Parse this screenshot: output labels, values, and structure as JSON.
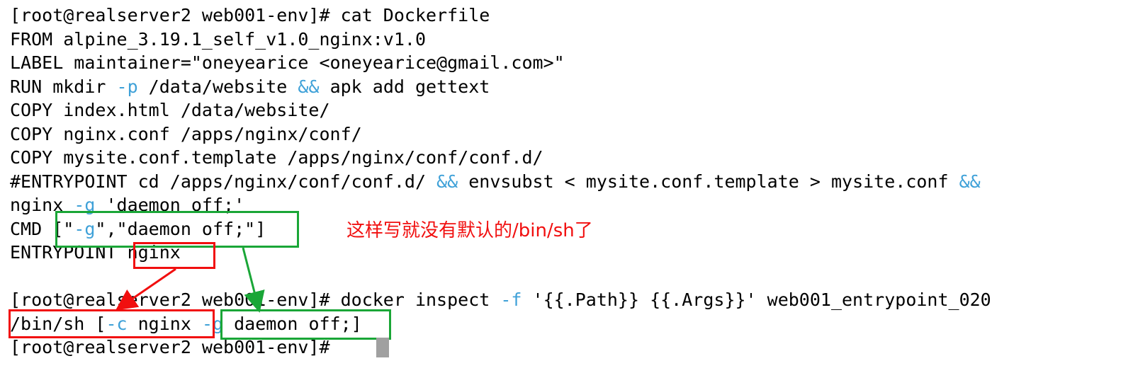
{
  "colors": {
    "background": "#ffffff",
    "text": "#000000",
    "flag_highlight": "#3fa1d8",
    "green_box": "#1aa637",
    "red_box": "#f10f0f",
    "annotation_text": "#f10f0f",
    "cursor": "#a0a0a0"
  },
  "terminal": {
    "lines": [
      [
        {
          "t": "[root@realserver2 web001-env]# cat Dockerfile"
        }
      ],
      [
        {
          "t": "FROM alpine_3.19.1_self_v1.0_nginx:v1.0"
        }
      ],
      [
        {
          "t": "LABEL maintainer=\"oneyearice <oneyearice@gmail.com>\""
        }
      ],
      [
        {
          "t": "RUN mkdir "
        },
        {
          "t": "-p",
          "c": "flag"
        },
        {
          "t": " /data/website "
        },
        {
          "t": "&&",
          "c": "flag"
        },
        {
          "t": " apk add gettext"
        }
      ],
      [
        {
          "t": "COPY index.html /data/website/"
        }
      ],
      [
        {
          "t": "COPY nginx.conf /apps/nginx/conf/"
        }
      ],
      [
        {
          "t": "COPY mysite.conf.template /apps/nginx/conf/conf.d/"
        }
      ],
      [
        {
          "t": "#ENTRYPOINT cd /apps/nginx/conf/conf.d/ "
        },
        {
          "t": "&&",
          "c": "flag"
        },
        {
          "t": " envsubst < mysite.conf.template > mysite.conf "
        },
        {
          "t": "&&",
          "c": "flag"
        }
      ],
      [
        {
          "t": "nginx "
        },
        {
          "t": "-g",
          "c": "flag"
        },
        {
          "t": " 'daemon off;'"
        }
      ],
      [
        {
          "t": "CMD [\""
        },
        {
          "t": "-g",
          "c": "flag"
        },
        {
          "t": "\",\"daemon off;\"]"
        }
      ],
      [
        {
          "t": "ENTRYPOINT nginx"
        }
      ],
      [
        {
          "t": ""
        }
      ],
      [
        {
          "t": "[root@realserver2 web001-env]# docker inspect "
        },
        {
          "t": "-f",
          "c": "flag"
        },
        {
          "t": " '{{.Path}} {{.Args}}' web001_entrypoint_020"
        }
      ],
      [
        {
          "t": "/bin/sh ["
        },
        {
          "t": "-c",
          "c": "flag"
        },
        {
          "t": " nginx "
        },
        {
          "t": "-g",
          "c": "flag"
        },
        {
          "t": " daemon off;]"
        }
      ],
      [
        {
          "t": "[root@realserver2 web001-env]# "
        }
      ]
    ]
  },
  "annotation": {
    "text": "这样写就没有默认的/bin/sh了"
  }
}
